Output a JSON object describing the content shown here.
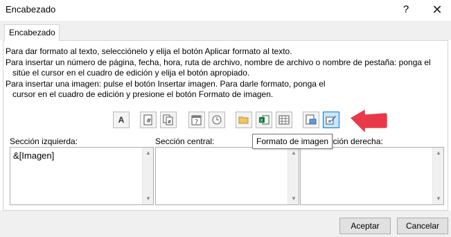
{
  "window": {
    "title": "Encabezado",
    "help": "?",
    "close": "✕"
  },
  "tab": {
    "label": "Encabezado"
  },
  "instructions": [
    "Para dar formato al texto, selecciónelo y elija el botón Aplicar formato al texto.",
    "Para insertar un número de página, fecha, hora, ruta de archivo, nombre de archivo o nombre de pestaña: ponga el",
    "sitúe el cursor en el cuadro de edición y elija el botón apropiado.",
    "Para insertar una imagen: pulse el botón Insertar imagen. Para darle formato, ponga el",
    "cursor en el cuadro de edición y presione el botón Formato de imagen."
  ],
  "toolbar": {
    "buttons": [
      {
        "icon": "format-text-icon",
        "glyph": "A"
      },
      {
        "icon": "page-number-icon",
        "glyph": "#"
      },
      {
        "icon": "number-of-pages-icon",
        "glyph": "##"
      },
      {
        "icon": "date-icon",
        "glyph": "7"
      },
      {
        "icon": "time-icon",
        "glyph": ""
      },
      {
        "icon": "file-path-icon",
        "glyph": ""
      },
      {
        "icon": "file-name-icon",
        "glyph": "x"
      },
      {
        "icon": "sheet-name-icon",
        "glyph": ""
      },
      {
        "icon": "insert-picture-icon",
        "glyph": ""
      },
      {
        "icon": "format-picture-icon",
        "glyph": ""
      }
    ]
  },
  "sections": {
    "left": {
      "label": "Sección izquierda:",
      "value": "&[Imagen]"
    },
    "center": {
      "label": "Sección central:",
      "value": ""
    },
    "right": {
      "label": "Sección derecha:",
      "value": ""
    }
  },
  "tooltip": {
    "text": "Formato de imagen"
  },
  "footer": {
    "accept": "Aceptar",
    "cancel": "Cancelar"
  },
  "colors": {
    "arrow": "#e8394a",
    "selected_button": "#cce4f7"
  }
}
